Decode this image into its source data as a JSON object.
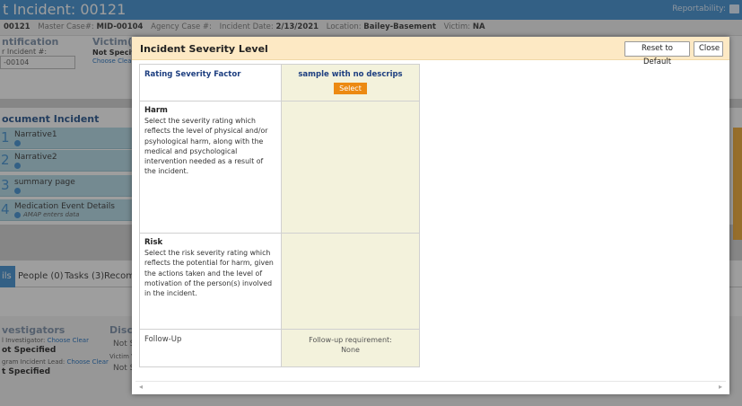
{
  "background": {
    "title": "t Incident: 00121",
    "reportability": "Reportability:",
    "info": {
      "id": "00121",
      "master_case_label": "Master Case#:",
      "master_case": "MID-00104",
      "agency_case_label": "Agency Case #:",
      "incident_date_label": "Incident Date:",
      "incident_date": "2/13/2021",
      "location_label": "Location:",
      "location": "Bailey-Basement",
      "victim_label": "Victim:",
      "victim": "NA"
    },
    "identification_heading": "ntification",
    "incident_num_label": "r Incident #:",
    "incident_num_value": "-00104",
    "victim_heading": "Victim(s",
    "victim_value": "Not Specif",
    "victim_links": "Choose  Clea",
    "document_heading": "ocument Incident",
    "doc_items": [
      {
        "num": "1",
        "label": "Narrative1",
        "sub": ""
      },
      {
        "num": "2",
        "label": "Narrative2",
        "sub": ""
      },
      {
        "num": "3",
        "label": "summary page",
        "sub": ""
      },
      {
        "num": "4",
        "label": "Medication Event Details",
        "sub": "AMAP enters data"
      }
    ],
    "tabs": [
      "ils",
      "People (0)",
      "Tasks (3)",
      "Recom"
    ],
    "investigators_heading": "vestigators",
    "investigator_label": "l Investigator:",
    "investigator_value": "ot Specified",
    "program_lead_label": "gram Incident Lead:",
    "program_lead_value": "t Specified",
    "choose": "Choose",
    "clear": "Clear",
    "disc_heading": "Discl",
    "disc_value_1": "Not S",
    "disc_victim": "Victim V",
    "disc_value_2": "Not S"
  },
  "modal": {
    "title": "Incident Severity Level",
    "reset_label": "Reset to Default",
    "close_label": "Close",
    "grid": {
      "header_left": "Rating Severity Factor",
      "option_name": "sample with no descrips",
      "select_label": "Select",
      "factors": [
        {
          "name": "Harm",
          "description": "Select the severity rating which reflects the level of physical and/or psyhological harm, along with the medical and psychological intervention needed as a result of the incident."
        },
        {
          "name": "Risk",
          "description": "Select the risk severity rating which reflects the potential for harm, given the actions taken and the level of motivation of the person(s) involved in the incident."
        }
      ],
      "followup_left": "Follow-Up",
      "followup_requirement_label": "Follow-up requirement:",
      "followup_requirement_value": "None"
    }
  },
  "colors": {
    "accent_blue": "#3d8fd1",
    "header_bg": "#fde9c4",
    "option_bg": "#f3f2dc",
    "select_button": "#ec8a12",
    "heading_text": "#1e3f80"
  }
}
